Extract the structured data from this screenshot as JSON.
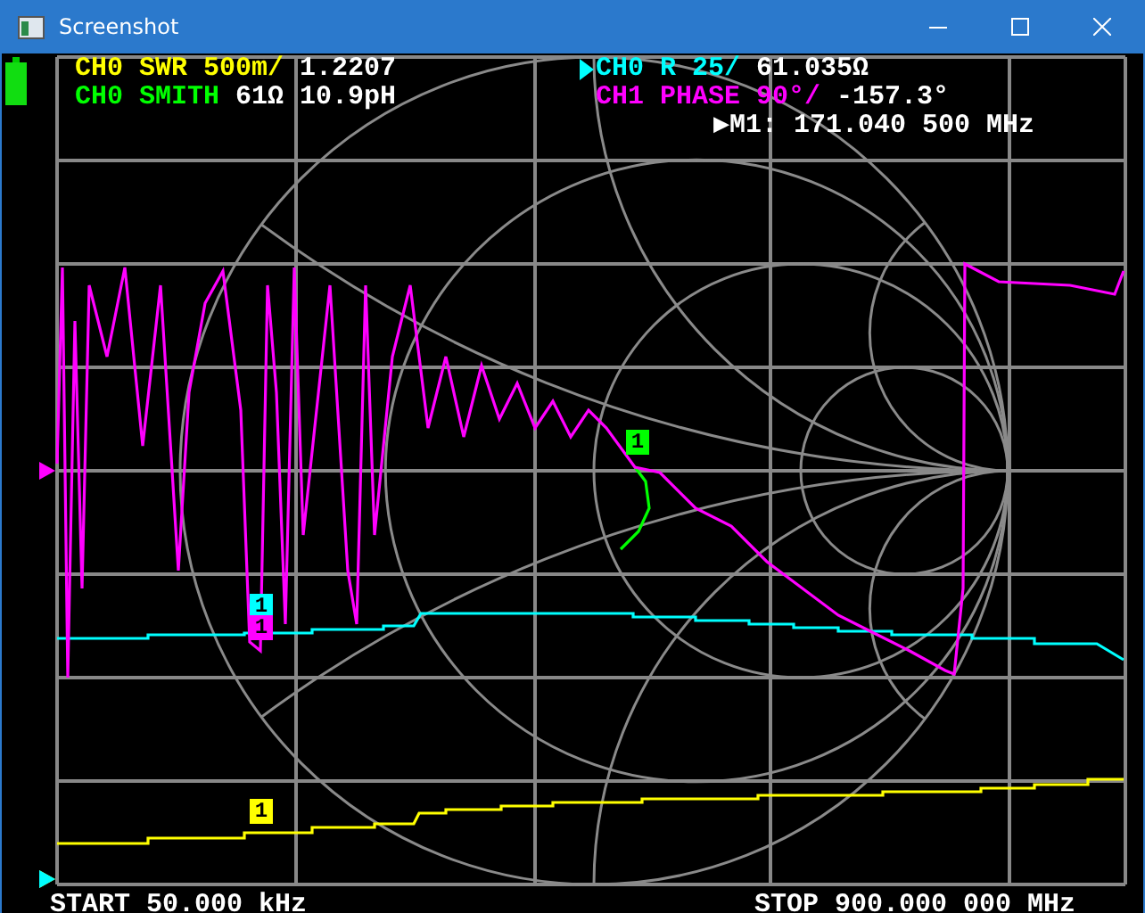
{
  "window": {
    "title": "Screenshot"
  },
  "traces": [
    {
      "name": "CH0 SWR 500m/",
      "value": "1.2207",
      "color": "#ffff00",
      "selected": false
    },
    {
      "name": "CH0 R 25/",
      "value": "61.035Ω",
      "color": "#00ffff",
      "selected": true
    },
    {
      "name": "CH0 SMITH",
      "value": "61Ω 10.9pH",
      "color": "#00ff00",
      "selected": false
    },
    {
      "name": "CH1 PHASE 90°/",
      "value": "-157.3°",
      "color": "#ff00ff",
      "selected": false
    }
  ],
  "marker_readout": "▶M1: 171.040 500 MHz",
  "markers": [
    {
      "label": "1",
      "color": "#00ff00"
    },
    {
      "label": "1",
      "color": "#00ffff"
    },
    {
      "label": "1",
      "color": "#ff00ff"
    },
    {
      "label": "1",
      "color": "#ffff00"
    }
  ],
  "start": "START 50.000 kHz",
  "stop": "STOP 900.000 000 MHz"
}
